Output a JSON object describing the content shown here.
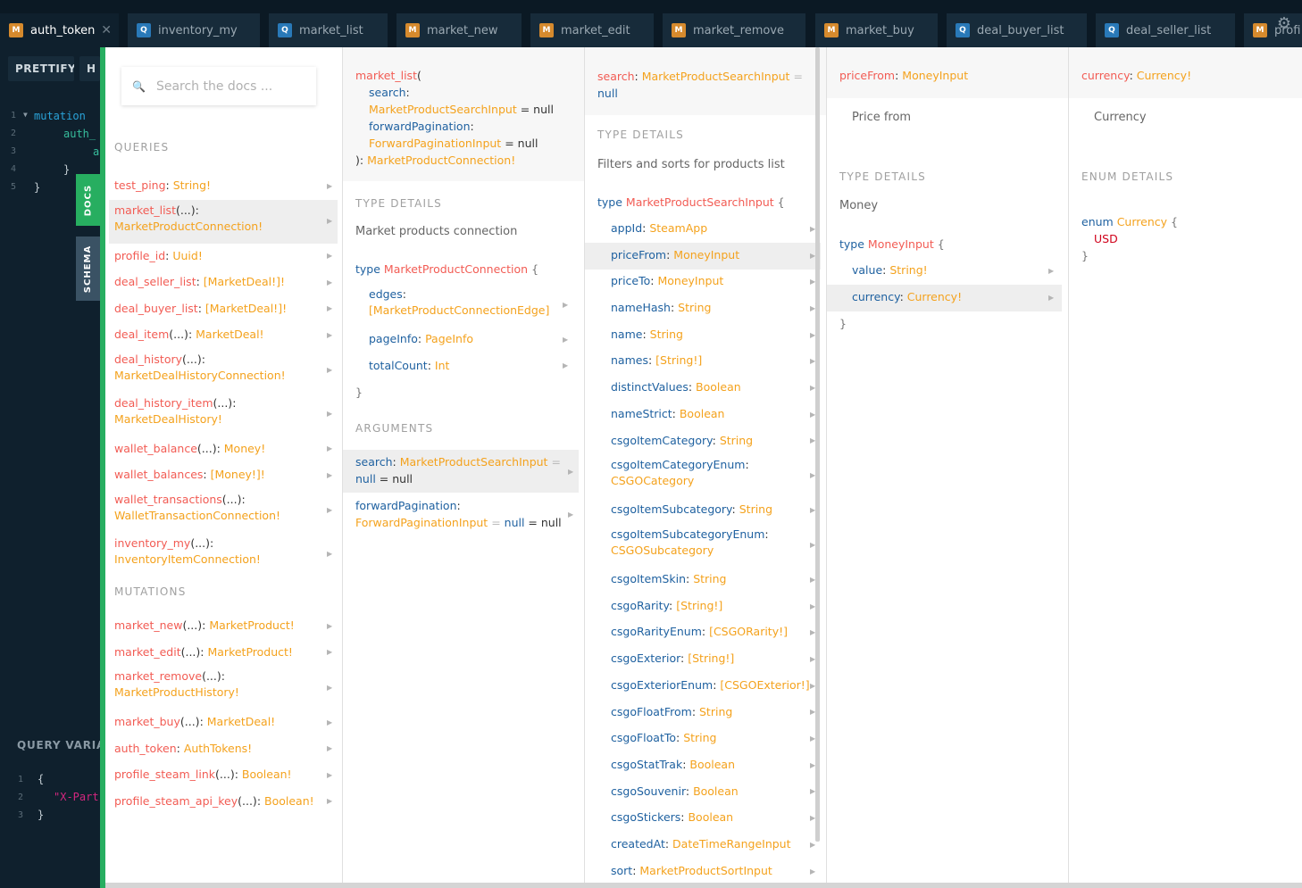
{
  "tabs": [
    {
      "type": "M",
      "label": "auth_token",
      "active": true,
      "close": "✕"
    },
    {
      "type": "Q",
      "label": "inventory_my"
    },
    {
      "type": "Q",
      "label": "market_list"
    },
    {
      "type": "M",
      "label": "market_new"
    },
    {
      "type": "M",
      "label": "market_edit"
    },
    {
      "type": "M",
      "label": "market_remove"
    },
    {
      "type": "M",
      "label": "market_buy"
    },
    {
      "type": "Q",
      "label": "deal_buyer_list"
    },
    {
      "type": "Q",
      "label": "deal_seller_list"
    },
    {
      "type": "M",
      "label": "profi"
    }
  ],
  "toolbar": {
    "prettify_label": "PRETTIFY",
    "history_label": "H"
  },
  "editor": {
    "lines": [
      {
        "n": "1",
        "text": "mutation",
        "cls": "kw"
      },
      {
        "n": "2",
        "text": "auth_",
        "cls": "fn"
      },
      {
        "n": "3",
        "text": "a",
        "cls": "fn"
      },
      {
        "n": "4",
        "text": "}",
        "cls": "br"
      },
      {
        "n": "5",
        "text": "}",
        "cls": "br"
      }
    ],
    "query_variables_title": "QUERY VARIA",
    "vars_lines": [
      {
        "n": "1",
        "text": "{",
        "cls": "br"
      },
      {
        "n": "2",
        "text": "\"X-Part",
        "cls": "str"
      },
      {
        "n": "3",
        "text": "}",
        "cls": "br"
      }
    ]
  },
  "sidetabs": {
    "docs": "DOCS",
    "schema": "SCHEMA"
  },
  "search": {
    "placeholder": "Search the docs ..."
  },
  "queries_title": "QUERIES",
  "queries": [
    {
      "name": "test_ping",
      "args": "",
      "type": "String!"
    },
    {
      "name": "market_list",
      "args": "(...)",
      "type": "MarketProductConnection!"
    },
    {
      "name": "profile_id",
      "args": "",
      "type": "Uuid!"
    },
    {
      "name": "deal_seller_list",
      "args": "",
      "type": "[MarketDeal!]!"
    },
    {
      "name": "deal_buyer_list",
      "args": "",
      "type": "[MarketDeal!]!"
    },
    {
      "name": "deal_item",
      "args": "(...)",
      "type": "MarketDeal!"
    },
    {
      "name": "deal_history",
      "args": "(...)",
      "type": "MarketDealHistoryConnection!"
    },
    {
      "name": "deal_history_item",
      "args": "(...)",
      "type": "MarketDealHistory!"
    },
    {
      "name": "wallet_balance",
      "args": "(...)",
      "type": "Money!"
    },
    {
      "name": "wallet_balances",
      "args": "",
      "type": "[Money!]!"
    },
    {
      "name": "wallet_transactions",
      "args": "(...)",
      "type": "WalletTransactionConnection!"
    },
    {
      "name": "inventory_my",
      "args": "(...)",
      "type": "InventoryItemConnection!"
    }
  ],
  "mutations_title": "MUTATIONS",
  "mutations": [
    {
      "name": "market_new",
      "args": "(...)",
      "type": "MarketProduct!"
    },
    {
      "name": "market_edit",
      "args": "(...)",
      "type": "MarketProduct!"
    },
    {
      "name": "market_remove",
      "args": "(...)",
      "type": "MarketProductHistory!"
    },
    {
      "name": "market_buy",
      "args": "(...)",
      "type": "MarketDeal!"
    },
    {
      "name": "auth_token",
      "args": "",
      "type": "AuthTokens!"
    },
    {
      "name": "profile_steam_link",
      "args": "(...)",
      "type": "Boolean!"
    },
    {
      "name": "profile_steam_api_key",
      "args": "(...)",
      "type": "Boolean!"
    }
  ],
  "col2": {
    "sig_name": "market_list",
    "sig_arg1": "search",
    "sig_arg1_type": "MarketProductSearchInput",
    "sig_arg2": "forwardPagination",
    "sig_arg2_type": "ForwardPaginationInput",
    "sig_default": "null",
    "sig_return": "MarketProductConnection!",
    "type_details_title": "TYPE DETAILS",
    "description": "Market products connection",
    "type_kw": "type",
    "type_name": "MarketProductConnection",
    "fields": [
      {
        "name": "edges",
        "type": "[MarketProductConnectionEdge]"
      },
      {
        "name": "pageInfo",
        "type": "PageInfo"
      },
      {
        "name": "totalCount",
        "type": "Int"
      }
    ],
    "arguments_title": "ARGUMENTS",
    "arguments": [
      {
        "name": "search",
        "type": "MarketProductSearchInput",
        "default": "null",
        "value": "null"
      },
      {
        "name": "forwardPagination",
        "type": "ForwardPaginationInput",
        "default": "null",
        "value": "null"
      }
    ]
  },
  "col3": {
    "head_name": "search",
    "head_type": "MarketProductSearchInput",
    "head_default": "null",
    "type_details_title": "TYPE DETAILS",
    "description": "Filters and sorts for products list",
    "type_kw": "type",
    "type_name": "MarketProductSearchInput",
    "fields": [
      {
        "name": "appId",
        "type": "SteamApp"
      },
      {
        "name": "priceFrom",
        "type": "MoneyInput"
      },
      {
        "name": "priceTo",
        "type": "MoneyInput"
      },
      {
        "name": "nameHash",
        "type": "String"
      },
      {
        "name": "name",
        "type": "String"
      },
      {
        "name": "names",
        "type": "[String!]"
      },
      {
        "name": "distinctValues",
        "type": "Boolean"
      },
      {
        "name": "nameStrict",
        "type": "Boolean"
      },
      {
        "name": "csgoItemCategory",
        "type": "String"
      },
      {
        "name": "csgoItemCategoryEnum",
        "type": "CSGOCategory"
      },
      {
        "name": "csgoItemSubcategory",
        "type": "String"
      },
      {
        "name": "csgoItemSubcategoryEnum",
        "type": "CSGOSubcategory"
      },
      {
        "name": "csgoItemSkin",
        "type": "String"
      },
      {
        "name": "csgoRarity",
        "type": "[String!]"
      },
      {
        "name": "csgoRarityEnum",
        "type": "[CSGORarity!]"
      },
      {
        "name": "csgoExterior",
        "type": "[String!]"
      },
      {
        "name": "csgoExteriorEnum",
        "type": "[CSGOExterior!]"
      },
      {
        "name": "csgoFloatFrom",
        "type": "String"
      },
      {
        "name": "csgoFloatTo",
        "type": "String"
      },
      {
        "name": "csgoStatTrak",
        "type": "Boolean"
      },
      {
        "name": "csgoSouvenir",
        "type": "Boolean"
      },
      {
        "name": "csgoStickers",
        "type": "Boolean"
      },
      {
        "name": "createdAt",
        "type": "DateTimeRangeInput"
      },
      {
        "name": "sort",
        "type": "MarketProductSortInput"
      }
    ]
  },
  "col4": {
    "head_name": "priceFrom",
    "head_type": "MoneyInput",
    "description": "Price from",
    "type_details_title": "TYPE DETAILS",
    "type_desc": "Money",
    "type_kw": "type",
    "type_name": "MoneyInput",
    "fields": [
      {
        "name": "value",
        "type": "String!"
      },
      {
        "name": "currency",
        "type": "Currency!"
      }
    ]
  },
  "col5": {
    "head_name": "currency",
    "head_type": "Currency!",
    "description": "Currency",
    "enum_details_title": "ENUM DETAILS",
    "enum_kw": "enum",
    "enum_name": "Currency",
    "values": [
      "USD"
    ]
  },
  "colors": {
    "accent": "#27ae60",
    "field_name": "#1f61a0",
    "type_name": "#f4a21d",
    "query_name": "#f25c54"
  }
}
